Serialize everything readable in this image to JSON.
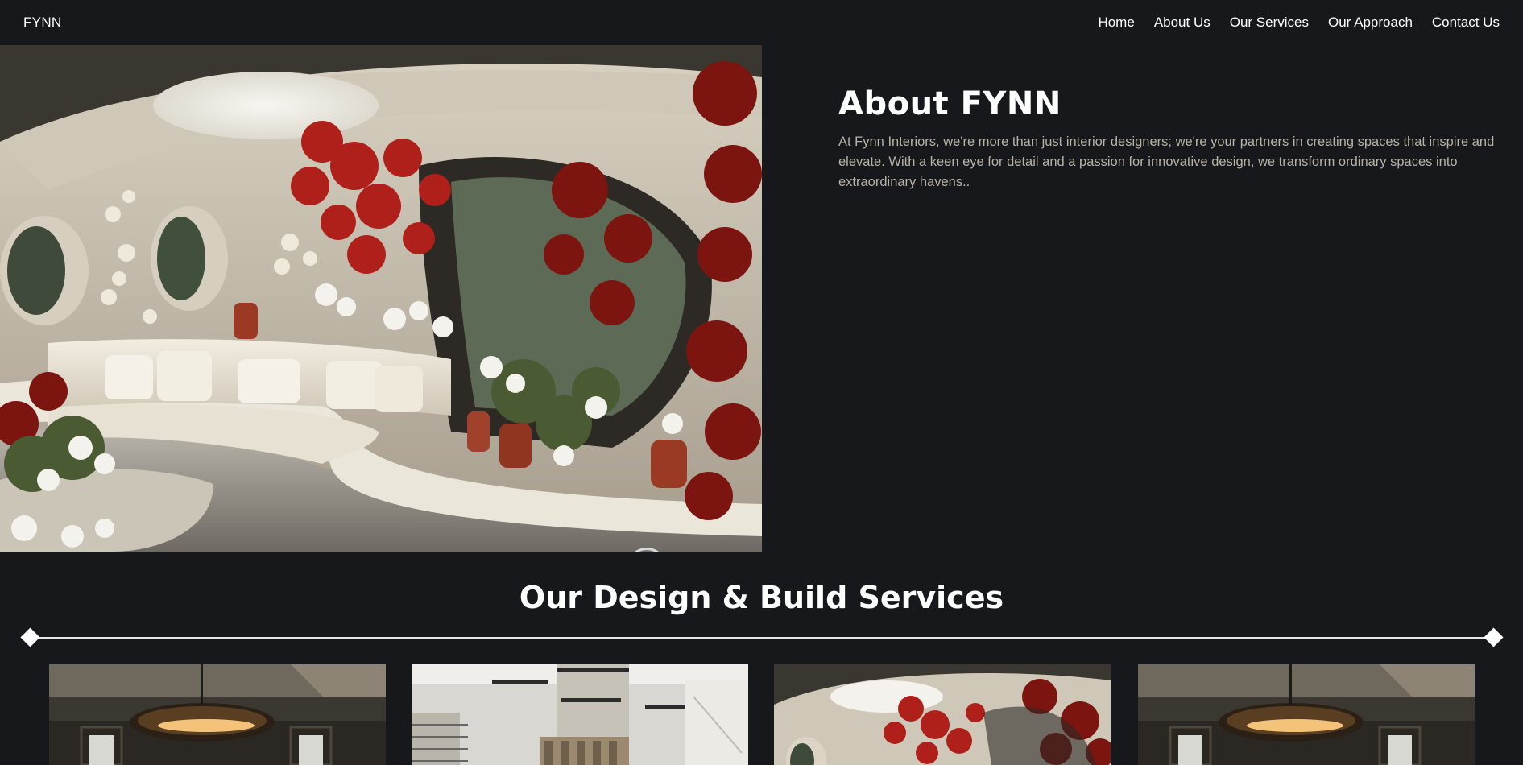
{
  "nav": {
    "brand": "FYNN",
    "links": [
      "Home",
      "About Us",
      "Our Services",
      "Our Approach",
      "Contact Us"
    ]
  },
  "about": {
    "title": "About FYNN",
    "text": "At Fynn Interiors, we're more than just interior designers; we're your partners in creating spaces that inspire and elevate. With a keen eye for detail and a passion for innovative design, we transform ordinary spaces into extraordinary havens.."
  },
  "services": {
    "title": "Our Design & Build Services",
    "cards": [
      {
        "image": "dark-living-room-with-pendant-lamp"
      },
      {
        "image": "bright-atrium-staircase"
      },
      {
        "image": "curved-lounge-with-red-flowers"
      },
      {
        "image": "dark-living-room-with-pendant-lamp"
      }
    ]
  },
  "colors": {
    "background": "#16181b",
    "text": "#ffffff",
    "muted_text": "#b8b2a6"
  }
}
